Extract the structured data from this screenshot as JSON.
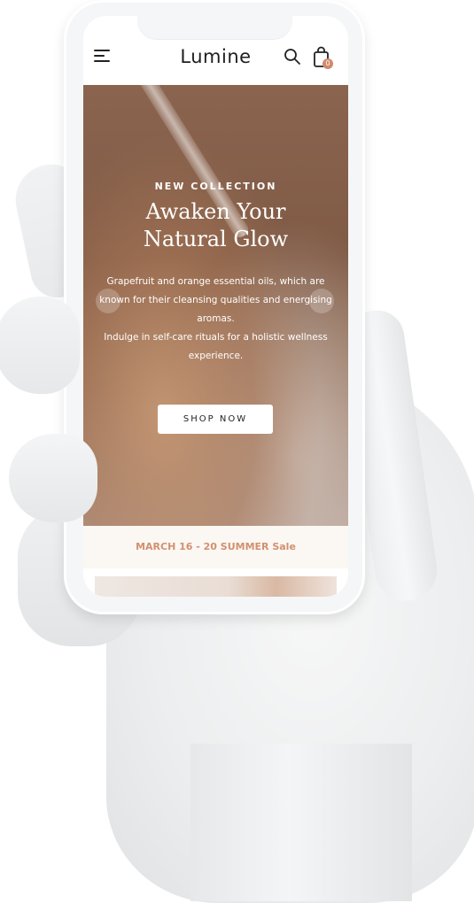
{
  "header": {
    "logo": "Lumine",
    "cart_count": "0"
  },
  "icons": {
    "menu": "menu-icon",
    "search": "search-icon",
    "cart": "shopping-bag-icon"
  },
  "hero": {
    "eyebrow": "NEW COLLECTION",
    "title_line1": "Awaken Your",
    "title_line2": "Natural Glow",
    "description_line1": "Grapefruit and orange essential oils, which are known for their cleansing qualities and energising aromas.",
    "description_line2": "Indulge in self-care rituals for a holistic wellness experience.",
    "cta": "SHOP NOW"
  },
  "sale_banner": "MARCH 16 - 20 SUMMER Sale",
  "colors": {
    "accent": "#d0896b",
    "hero_brown": "#8a644f",
    "sale_background": "#fbf7f3"
  }
}
